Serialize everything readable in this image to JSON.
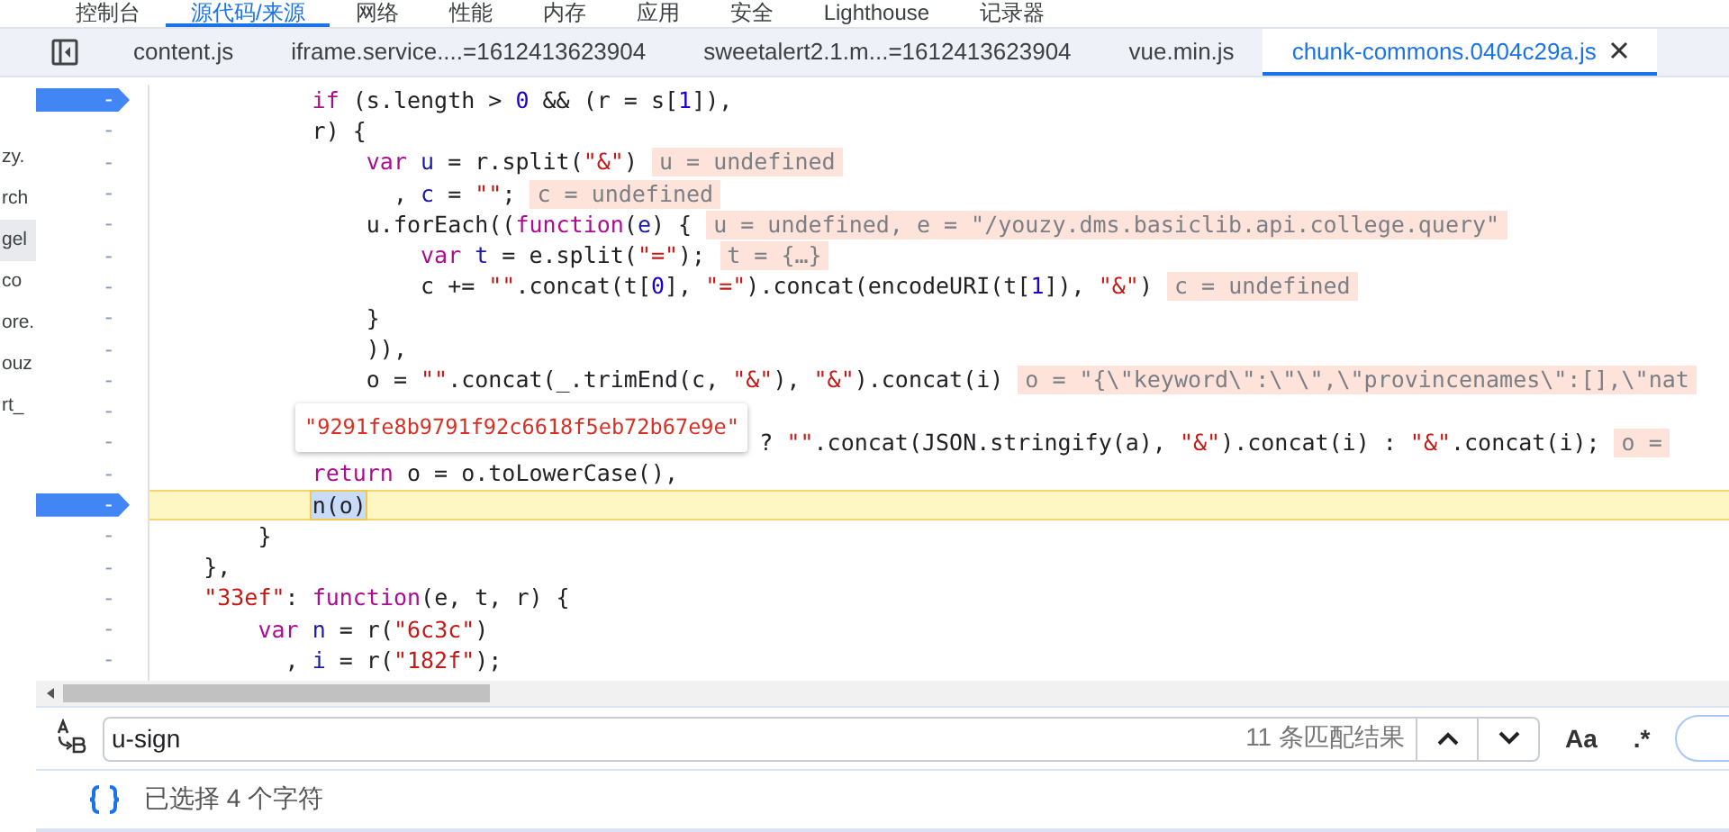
{
  "panel_tabs": [
    {
      "label": "控制台",
      "selected": false
    },
    {
      "label": "源代码/来源",
      "selected": true
    },
    {
      "label": "网络",
      "selected": false
    },
    {
      "label": "性能",
      "selected": false
    },
    {
      "label": "内存",
      "selected": false
    },
    {
      "label": "应用",
      "selected": false
    },
    {
      "label": "安全",
      "selected": false
    },
    {
      "label": "Lighthouse",
      "selected": false
    },
    {
      "label": "记录器",
      "selected": false
    }
  ],
  "file_tabs": [
    {
      "label": "content.js",
      "selected": false
    },
    {
      "label": "iframe.service....=1612413623904",
      "selected": false
    },
    {
      "label": "sweetalert2.1.m...=1612413623904",
      "selected": false
    },
    {
      "label": "vue.min.js",
      "selected": false
    },
    {
      "label": "chunk-commons.0404c29a.js",
      "selected": true
    }
  ],
  "navigator": {
    "items": [
      {
        "label": "zy.",
        "selected": false
      },
      {
        "label": "rch",
        "selected": false
      },
      {
        "label": "gel",
        "selected": true
      },
      {
        "label": "co",
        "selected": false
      },
      {
        "label": "ore.",
        "selected": false
      },
      {
        "label": "ouz",
        "selected": false
      },
      {
        "label": "rt_",
        "selected": false
      }
    ]
  },
  "editor": {
    "lines": [
      {
        "gutter": "-",
        "breakpoint": true,
        "current": false,
        "tokens": [
          {
            "kind": "keyword",
            "text": "            if"
          },
          {
            "kind": "plain",
            "text": " (s.length > "
          },
          {
            "kind": "number",
            "text": "0"
          },
          {
            "kind": "plain",
            "text": " && (r = s["
          },
          {
            "kind": "number",
            "text": "1"
          },
          {
            "kind": "plain",
            "text": "]),"
          }
        ]
      },
      {
        "gutter": "-",
        "breakpoint": false,
        "current": false,
        "tokens": [
          {
            "kind": "plain",
            "text": "            r) {"
          }
        ]
      },
      {
        "gutter": "-",
        "breakpoint": false,
        "current": false,
        "tokens": [
          {
            "kind": "keyword",
            "text": "                var"
          },
          {
            "kind": "name",
            "text": " u"
          },
          {
            "kind": "plain",
            "text": " = r.split("
          },
          {
            "kind": "string",
            "text": "\"&\""
          },
          {
            "kind": "plain",
            "text": ")"
          }
        ],
        "value": "u = undefined"
      },
      {
        "gutter": "-",
        "breakpoint": false,
        "current": false,
        "tokens": [
          {
            "kind": "plain",
            "text": "                  , "
          },
          {
            "kind": "name",
            "text": "c"
          },
          {
            "kind": "plain",
            "text": " = "
          },
          {
            "kind": "string",
            "text": "\"\""
          },
          {
            "kind": "plain",
            "text": ";"
          }
        ],
        "value": "c = undefined"
      },
      {
        "gutter": "-",
        "breakpoint": false,
        "current": false,
        "tokens": [
          {
            "kind": "plain",
            "text": "                u.forEach(("
          },
          {
            "kind": "keyword",
            "text": "function"
          },
          {
            "kind": "plain",
            "text": "("
          },
          {
            "kind": "name",
            "text": "e"
          },
          {
            "kind": "plain",
            "text": ") {"
          }
        ],
        "value": "u = undefined, e = \"/youzy.dms.basiclib.api.college.query\""
      },
      {
        "gutter": "-",
        "breakpoint": false,
        "current": false,
        "tokens": [
          {
            "kind": "keyword",
            "text": "                    var"
          },
          {
            "kind": "name",
            "text": " t"
          },
          {
            "kind": "plain",
            "text": " = e.split("
          },
          {
            "kind": "string",
            "text": "\"=\""
          },
          {
            "kind": "plain",
            "text": ");"
          }
        ],
        "value": "t = {…}"
      },
      {
        "gutter": "-",
        "breakpoint": false,
        "current": false,
        "tokens": [
          {
            "kind": "plain",
            "text": "                    c += "
          },
          {
            "kind": "string",
            "text": "\"\""
          },
          {
            "kind": "plain",
            "text": ".concat(t["
          },
          {
            "kind": "number",
            "text": "0"
          },
          {
            "kind": "plain",
            "text": "], "
          },
          {
            "kind": "string",
            "text": "\"=\""
          },
          {
            "kind": "plain",
            "text": ").concat(encodeURI(t["
          },
          {
            "kind": "number",
            "text": "1"
          },
          {
            "kind": "plain",
            "text": "]), "
          },
          {
            "kind": "string",
            "text": "\"&\""
          },
          {
            "kind": "plain",
            "text": ")"
          }
        ],
        "value": "c = undefined"
      },
      {
        "gutter": "-",
        "breakpoint": false,
        "current": false,
        "tokens": [
          {
            "kind": "plain",
            "text": "                }"
          }
        ]
      },
      {
        "gutter": "-",
        "breakpoint": false,
        "current": false,
        "tokens": [
          {
            "kind": "plain",
            "text": "                )),"
          }
        ]
      },
      {
        "gutter": "-",
        "breakpoint": false,
        "current": false,
        "tokens": [
          {
            "kind": "plain",
            "text": "                o = "
          },
          {
            "kind": "string",
            "text": "\"\""
          },
          {
            "kind": "plain",
            "text": ".concat(_.trimEnd(c, "
          },
          {
            "kind": "string",
            "text": "\"&\""
          },
          {
            "kind": "plain",
            "text": "), "
          },
          {
            "kind": "string",
            "text": "\"&\""
          },
          {
            "kind": "plain",
            "text": ").concat(i)"
          }
        ],
        "value": "o = \"{\\\"keyword\\\":\\\"\\\",\\\"provincenames\\\":[],\\\"nat"
      },
      {
        "gutter": "-",
        "breakpoint": false,
        "current": false
      },
      {
        "gutter": "-",
        "breakpoint": false,
        "current": false,
        "tokens": [
          {
            "kind": "plain",
            "text": "                                             ? "
          },
          {
            "kind": "string",
            "text": "\"\""
          },
          {
            "kind": "plain",
            "text": ".concat(JSON.stringify(a), "
          },
          {
            "kind": "string",
            "text": "\"&\""
          },
          {
            "kind": "plain",
            "text": ").concat(i) : "
          },
          {
            "kind": "string",
            "text": "\"&\""
          },
          {
            "kind": "plain",
            "text": ".concat(i);"
          }
        ],
        "value": "o ="
      },
      {
        "gutter": "-",
        "breakpoint": false,
        "current": false,
        "tokens": [
          {
            "kind": "keyword",
            "text": "            return"
          },
          {
            "kind": "plain",
            "text": " o = o.toLowerCase(),"
          }
        ]
      },
      {
        "gutter": "-",
        "breakpoint": true,
        "current": true,
        "tokens": [
          {
            "kind": "selected",
            "text": "n(o)"
          }
        ]
      },
      {
        "gutter": "-",
        "breakpoint": false,
        "current": false,
        "tokens": [
          {
            "kind": "plain",
            "text": "        }"
          }
        ]
      },
      {
        "gutter": "-",
        "breakpoint": false,
        "current": false,
        "tokens": [
          {
            "kind": "plain",
            "text": "    },"
          }
        ]
      },
      {
        "gutter": "-",
        "breakpoint": false,
        "current": false,
        "tokens": [
          {
            "kind": "string",
            "text": "    \"33ef\""
          },
          {
            "kind": "plain",
            "text": ": "
          },
          {
            "kind": "keyword",
            "text": "function"
          },
          {
            "kind": "plain",
            "text": "(e, t, r) {"
          }
        ]
      },
      {
        "gutter": "-",
        "breakpoint": false,
        "current": false,
        "tokens": [
          {
            "kind": "keyword",
            "text": "        var"
          },
          {
            "kind": "name",
            "text": " n"
          },
          {
            "kind": "plain",
            "text": " = r("
          },
          {
            "kind": "string",
            "text": "\"6c3c\""
          },
          {
            "kind": "plain",
            "text": ")"
          }
        ]
      },
      {
        "gutter": "-",
        "breakpoint": false,
        "current": false,
        "tokens": [
          {
            "kind": "plain",
            "text": "          , "
          },
          {
            "kind": "name",
            "text": "i"
          },
          {
            "kind": "plain",
            "text": " = r("
          },
          {
            "kind": "string",
            "text": "\"182f\""
          },
          {
            "kind": "plain",
            "text": ");"
          }
        ]
      }
    ],
    "tooltip": {
      "text": "\"9291fe8b9791f92c6618f5eb72b67e9e\""
    }
  },
  "search": {
    "value": "u-sign",
    "match_count": "11 条匹配结果",
    "match_case_label": "Aa",
    "regex_label": ".*"
  },
  "status": {
    "text": "已选择 4 个字符"
  }
}
